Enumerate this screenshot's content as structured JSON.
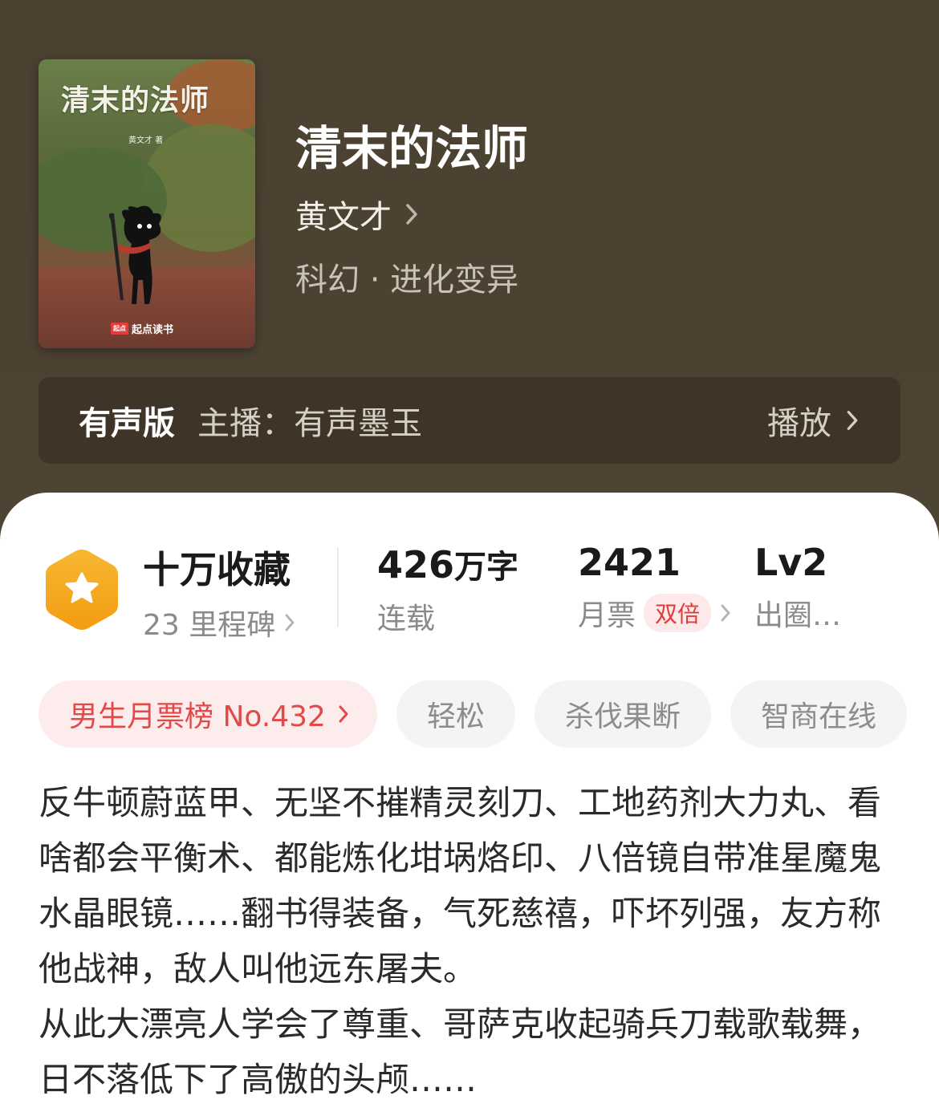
{
  "cover": {
    "title": "清末的法师",
    "author": "黄文才 著",
    "publisher": "起点读书",
    "publisher_badge": "起点"
  },
  "book": {
    "title": "清末的法师",
    "author": "黄文才",
    "genre": "科幻 · 进化变异"
  },
  "audio": {
    "label": "有声版",
    "host": "主播：有声墨玉",
    "play": "播放"
  },
  "stats": {
    "collection_main": "十万收藏",
    "collection_sub": "23 里程碑",
    "words_value": "426",
    "words_unit": "万字",
    "words_sub": "连载",
    "tickets_value": "2421",
    "tickets_sub": "月票",
    "tickets_badge": "双倍",
    "level_value": "Lv2",
    "level_sub": "出圈…"
  },
  "tags": {
    "rank": "男生月票榜 No.432",
    "tag1": "轻松",
    "tag2": "杀伐果断",
    "tag3": "智商在线"
  },
  "synopsis": {
    "para1": "反牛顿蔚蓝甲、无坚不摧精灵刻刀、工地药剂大力丸、看啥都会平衡术、都能炼化坩埚烙印、八倍镜自带准星魔鬼水晶眼镜……翻书得装备，气死慈禧，吓坏列强，友方称他战神，敌人叫他远东屠夫。",
    "para2": "从此大漂亮人学会了尊重、哥萨克收起骑兵刀载歌载舞，日不落低下了高傲的头颅……"
  },
  "colors": {
    "hero_bg": "#4b4131",
    "accent_red": "#e24a4a",
    "badge_orange": "#f5a623"
  }
}
